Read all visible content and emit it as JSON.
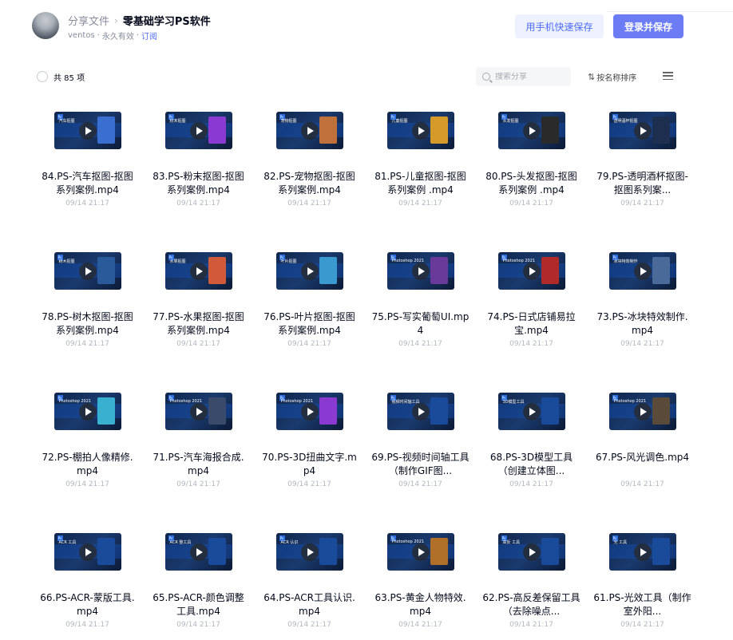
{
  "header": {
    "crumb_parent": "分享文件",
    "crumb_sep": "›",
    "title": "零基础学习PS软件",
    "owner": "ventos",
    "validity": "永久有效",
    "subscribe": "订阅",
    "mobile_save_button": "用手机快速保存",
    "login_save_button": "登录并保存"
  },
  "toolbar": {
    "count": "共 85 项",
    "search_placeholder": "搜索分享",
    "sort_label": "按名称排序"
  },
  "files": [
    {
      "name": "84.PS-汽车抠图-抠图系列案例.mp4",
      "date": "09/14 21:17",
      "thumb_label": "汽车抠图",
      "art": "#3a6fd0"
    },
    {
      "name": "83.PS-粉末抠图-抠图系列案例.mp4",
      "date": "09/14 21:17",
      "thumb_label": "粉末抠图",
      "art": "#8a3ad0"
    },
    {
      "name": "82.PS-宠物抠图-抠图系列案例.mp4",
      "date": "09/14 21:17",
      "thumb_label": "宠物抠图",
      "art": "#c0703a"
    },
    {
      "name": "81.PS-儿童抠图-抠图系列案例 .mp4",
      "date": "09/14 21:17",
      "thumb_label": "儿童抠图",
      "art": "#d69a2a"
    },
    {
      "name": "80.PS-头发抠图-抠图系列案例 .mp4",
      "date": "09/14 21:17",
      "thumb_label": "头发抠图",
      "art": "#2a2a2a"
    },
    {
      "name": "79.PS-透明酒杯抠图-抠图系列案...",
      "date": "09/14 21:17",
      "thumb_label": "透明酒杯抠图",
      "art": "#1e2e4e"
    },
    {
      "name": "78.PS-树木抠图-抠图系列案例.mp4",
      "date": "09/14 21:17",
      "thumb_label": "树木抠图",
      "art": "#2a5a9a"
    },
    {
      "name": "77.PS-水果抠图-抠图系列案例.mp4",
      "date": "09/14 21:17",
      "thumb_label": "水果抠图",
      "art": "#d05a3a"
    },
    {
      "name": "76.PS-叶片抠图-抠图系列案例.mp4",
      "date": "09/14 21:17",
      "thumb_label": "叶片抠图",
      "art": "#3a9ad0"
    },
    {
      "name": "75.PS-写实葡萄UI.mp4",
      "date": "09/14 21:17",
      "thumb_label": "Photoshop 2021",
      "art": "#6a3a9a"
    },
    {
      "name": "74.PS-日式店铺易拉宝.mp4",
      "date": "09/14 21:17",
      "thumb_label": "Photoshop 2021",
      "art": "#b02a2a"
    },
    {
      "name": "73.PS-冰块特效制作.mp4",
      "date": "09/14 21:17",
      "thumb_label": "冰块特效制作",
      "art": "#4a6a9a"
    },
    {
      "name": "72.PS-棚拍人像精修.mp4",
      "date": "09/14 21:17",
      "thumb_label": "Photoshop 2021",
      "art": "#3ab0d0"
    },
    {
      "name": "71.PS-汽车海报合成.mp4",
      "date": "09/14 21:17",
      "thumb_label": "Photoshop 2021",
      "art": "#3a4a6a"
    },
    {
      "name": "70.PS-3D扭曲文字.mp4",
      "date": "09/14 21:17",
      "thumb_label": "Photoshop 2021",
      "art": "#8a3ad0"
    },
    {
      "name": "69.PS-视频时间轴工具（制作GIF图...",
      "date": "09/14 21:17",
      "thumb_label": "视频时间轴工具",
      "art": "#1a4a9a"
    },
    {
      "name": "68.PS-3D模型工具（创建立体图...",
      "date": "09/14 21:17",
      "thumb_label": "3D模型工具",
      "art": "#1a4a9a"
    },
    {
      "name": "67.PS-风光调色.mp4",
      "date": "09/14 21:17",
      "thumb_label": "Photoshop 2021",
      "art": "#5a4a3a"
    },
    {
      "name": "66.PS-ACR-蒙版工具.mp4",
      "date": "09/14 21:17",
      "thumb_label": "ACR 工具",
      "art": "#1a4a9a"
    },
    {
      "name": "65.PS-ACR-颜色调整工具.mp4",
      "date": "09/14 21:17",
      "thumb_label": "ACR 整工具",
      "art": "#1a4a9a"
    },
    {
      "name": "64.PS-ACR工具认识.mp4",
      "date": "09/14 21:17",
      "thumb_label": "ACR 认识",
      "art": "#1a4a9a"
    },
    {
      "name": "63.PS-黄金人物特效.mp4",
      "date": "09/14 21:17",
      "thumb_label": "Photoshop 2021",
      "art": "#b0702a"
    },
    {
      "name": "62.PS-高反差保留工具（去除噪点...",
      "date": "09/14 21:17",
      "thumb_label": "高反 工具",
      "art": "#1a4a9a"
    },
    {
      "name": "61.PS-光效工具（制作室外阳...",
      "date": "09/14 21:17",
      "thumb_label": "光 工具",
      "art": "#1a4a9a"
    }
  ]
}
